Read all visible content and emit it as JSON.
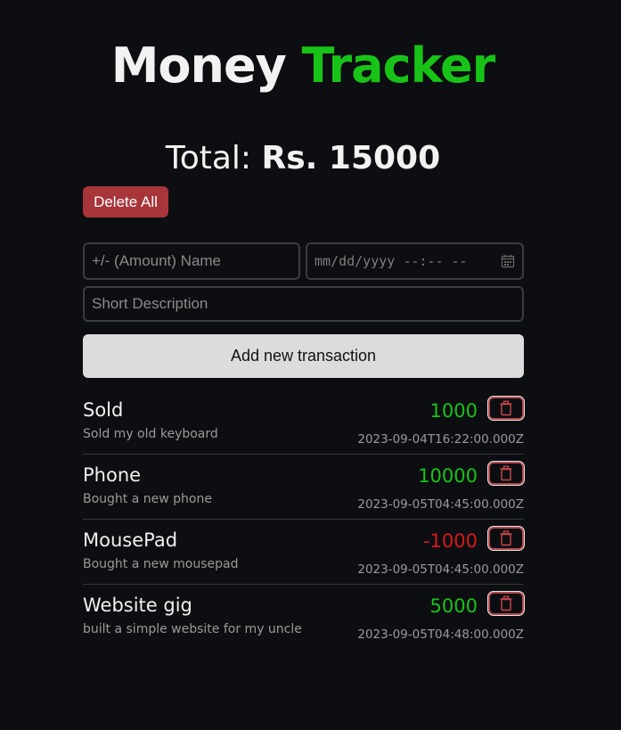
{
  "header": {
    "title_part1": "Money",
    "title_part2": "Tracker",
    "accent_color": "#18c318"
  },
  "summary": {
    "total_label": "Total:",
    "total_value": "Rs. 15000"
  },
  "actions": {
    "delete_all_label": "Delete All",
    "add_button_label": "Add new transaction"
  },
  "form": {
    "name_placeholder": "+/- (Amount) Name",
    "datetime_placeholder": "mm/dd/yyyy --:-- --",
    "description_placeholder": "Short Description"
  },
  "colors": {
    "positive": "#18c318",
    "negative": "#d8191c",
    "danger": "#a7353a"
  },
  "transactions": [
    {
      "name": "Sold",
      "description": "Sold my old keyboard",
      "amount": "1000",
      "datetime": "2023-09-04T16:22:00.000Z",
      "sign": "positive"
    },
    {
      "name": "Phone",
      "description": "Bought a new phone",
      "amount": "10000",
      "datetime": "2023-09-05T04:45:00.000Z",
      "sign": "positive"
    },
    {
      "name": "MousePad",
      "description": "Bought a new mousepad",
      "amount": "-1000",
      "datetime": "2023-09-05T04:45:00.000Z",
      "sign": "negative"
    },
    {
      "name": "Website gig",
      "description": "built a simple website for my uncle",
      "amount": "5000",
      "datetime": "2023-09-05T04:48:00.000Z",
      "sign": "positive"
    }
  ]
}
